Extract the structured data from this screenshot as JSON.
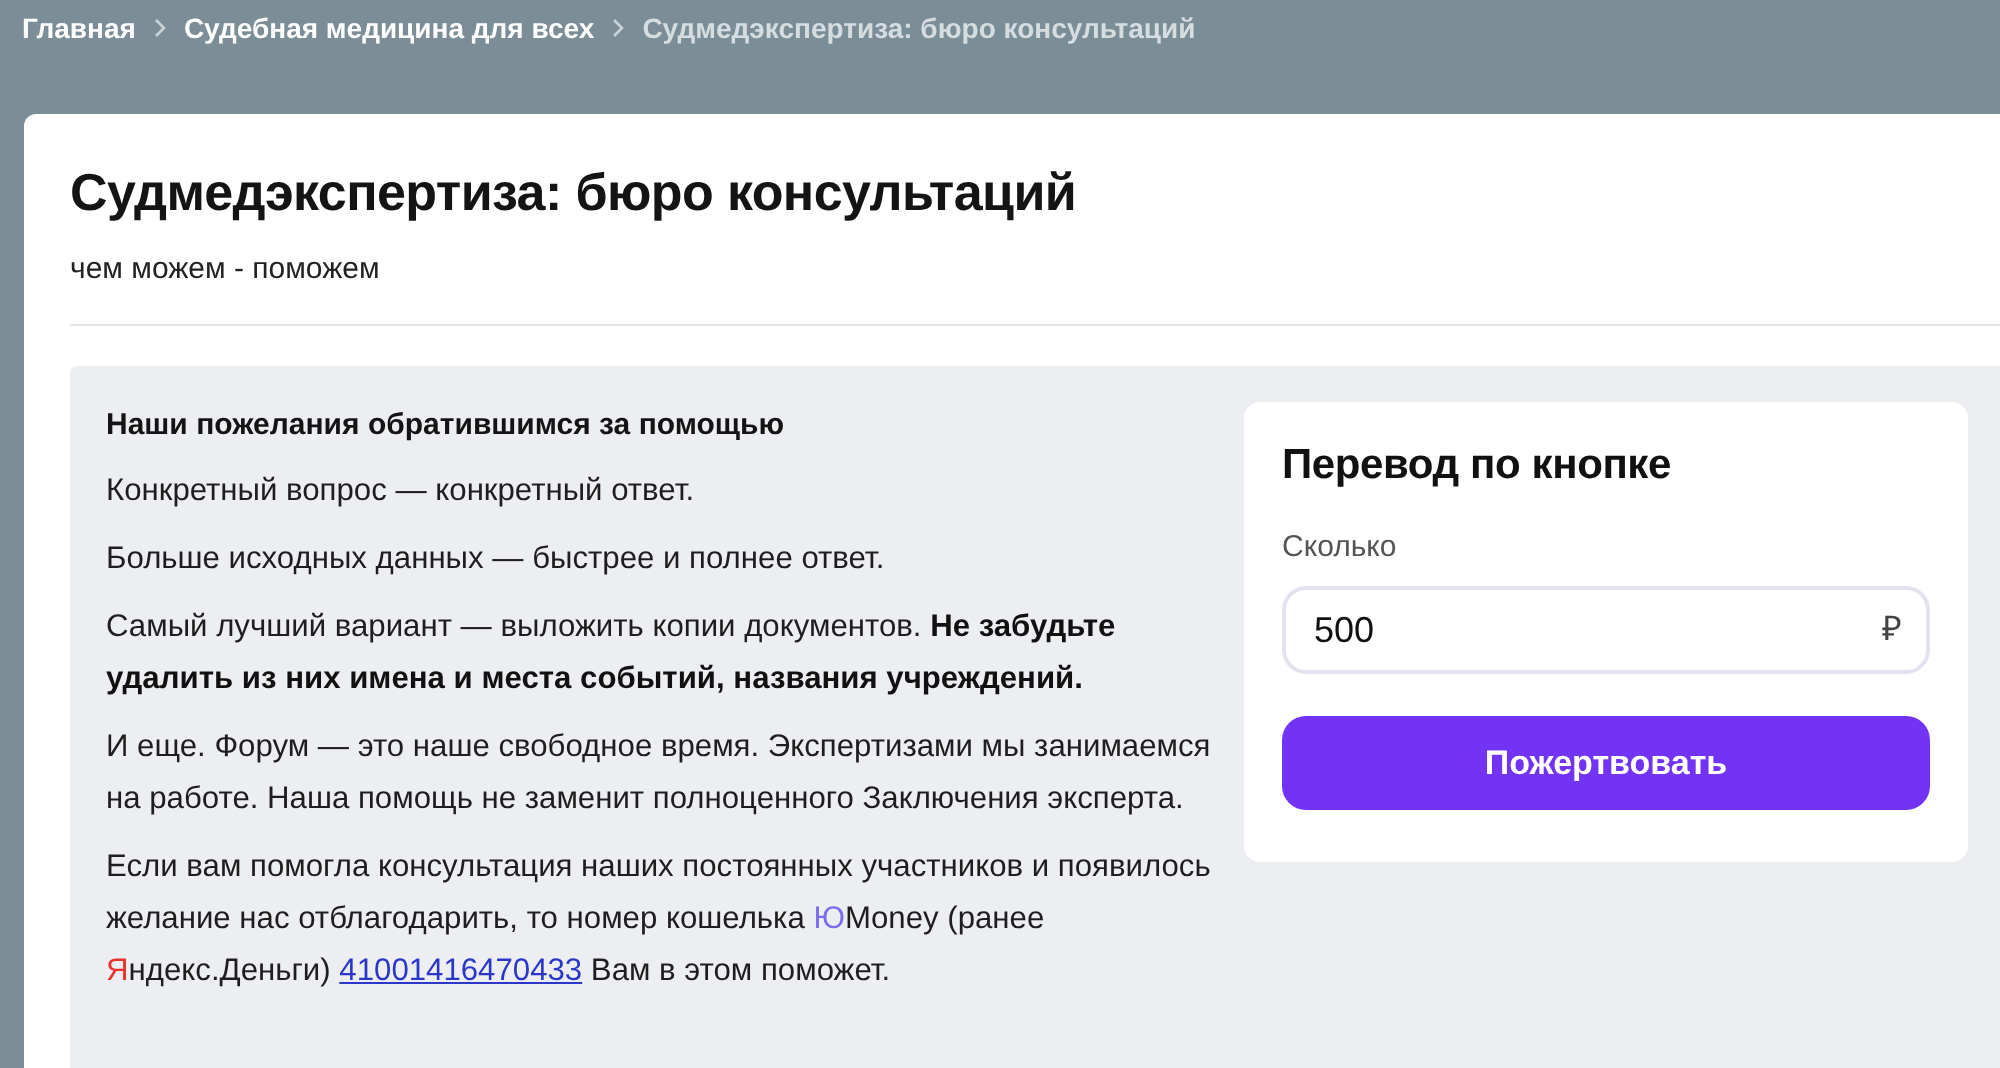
{
  "breadcrumbs": [
    {
      "label": "Главная",
      "current": false
    },
    {
      "label": "Судебная медицина для всех",
      "current": false
    },
    {
      "label": "Судмедэкспертиза: бюро консультаций",
      "current": true
    }
  ],
  "header": {
    "title": "Судмедэкспертиза: бюро консультаций",
    "subtitle": "чем можем - поможем"
  },
  "notice": {
    "heading": "Наши пожелания обратившимся за помощью",
    "paragraphs": [
      [
        {
          "kind": "plain",
          "text": "Конкретный вопрос — конкретный ответ."
        }
      ],
      [
        {
          "kind": "plain",
          "text": "Больше исходных данных — быстрее и полнее ответ."
        }
      ],
      [
        {
          "kind": "plain",
          "text": "Самый лучший вариант — выложить копии документов. "
        },
        {
          "kind": "bold",
          "text": "Не забудьте удалить из них имена и места событий, названия учреждений."
        }
      ],
      [
        {
          "kind": "plain",
          "text": "И еще. Форум — это наше свободное время. Экспертизами мы занимаемся на работе. Наша помощь не заменит полноценного Заключения эксперта."
        }
      ],
      [
        {
          "kind": "plain",
          "text": "Если вам помогла консультация наших постоянных участников и появилось желание нас отблагодарить, то номер кошелька "
        },
        {
          "kind": "brand",
          "color": "#7b6cf0",
          "text": "Ю"
        },
        {
          "kind": "plain",
          "text": "Money (ранее "
        },
        {
          "kind": "brand",
          "color": "#e8322c",
          "text": "Я"
        },
        {
          "kind": "plain",
          "text": "ндекс.Деньги) "
        },
        {
          "kind": "link",
          "text": "41001416470433"
        },
        {
          "kind": "plain",
          "text": " Вам в этом поможет."
        }
      ]
    ]
  },
  "donate": {
    "title": "Перевод по кнопке",
    "amount_label": "Сколько",
    "amount": "500",
    "currency": "₽",
    "button": "Пожертвовать"
  }
}
